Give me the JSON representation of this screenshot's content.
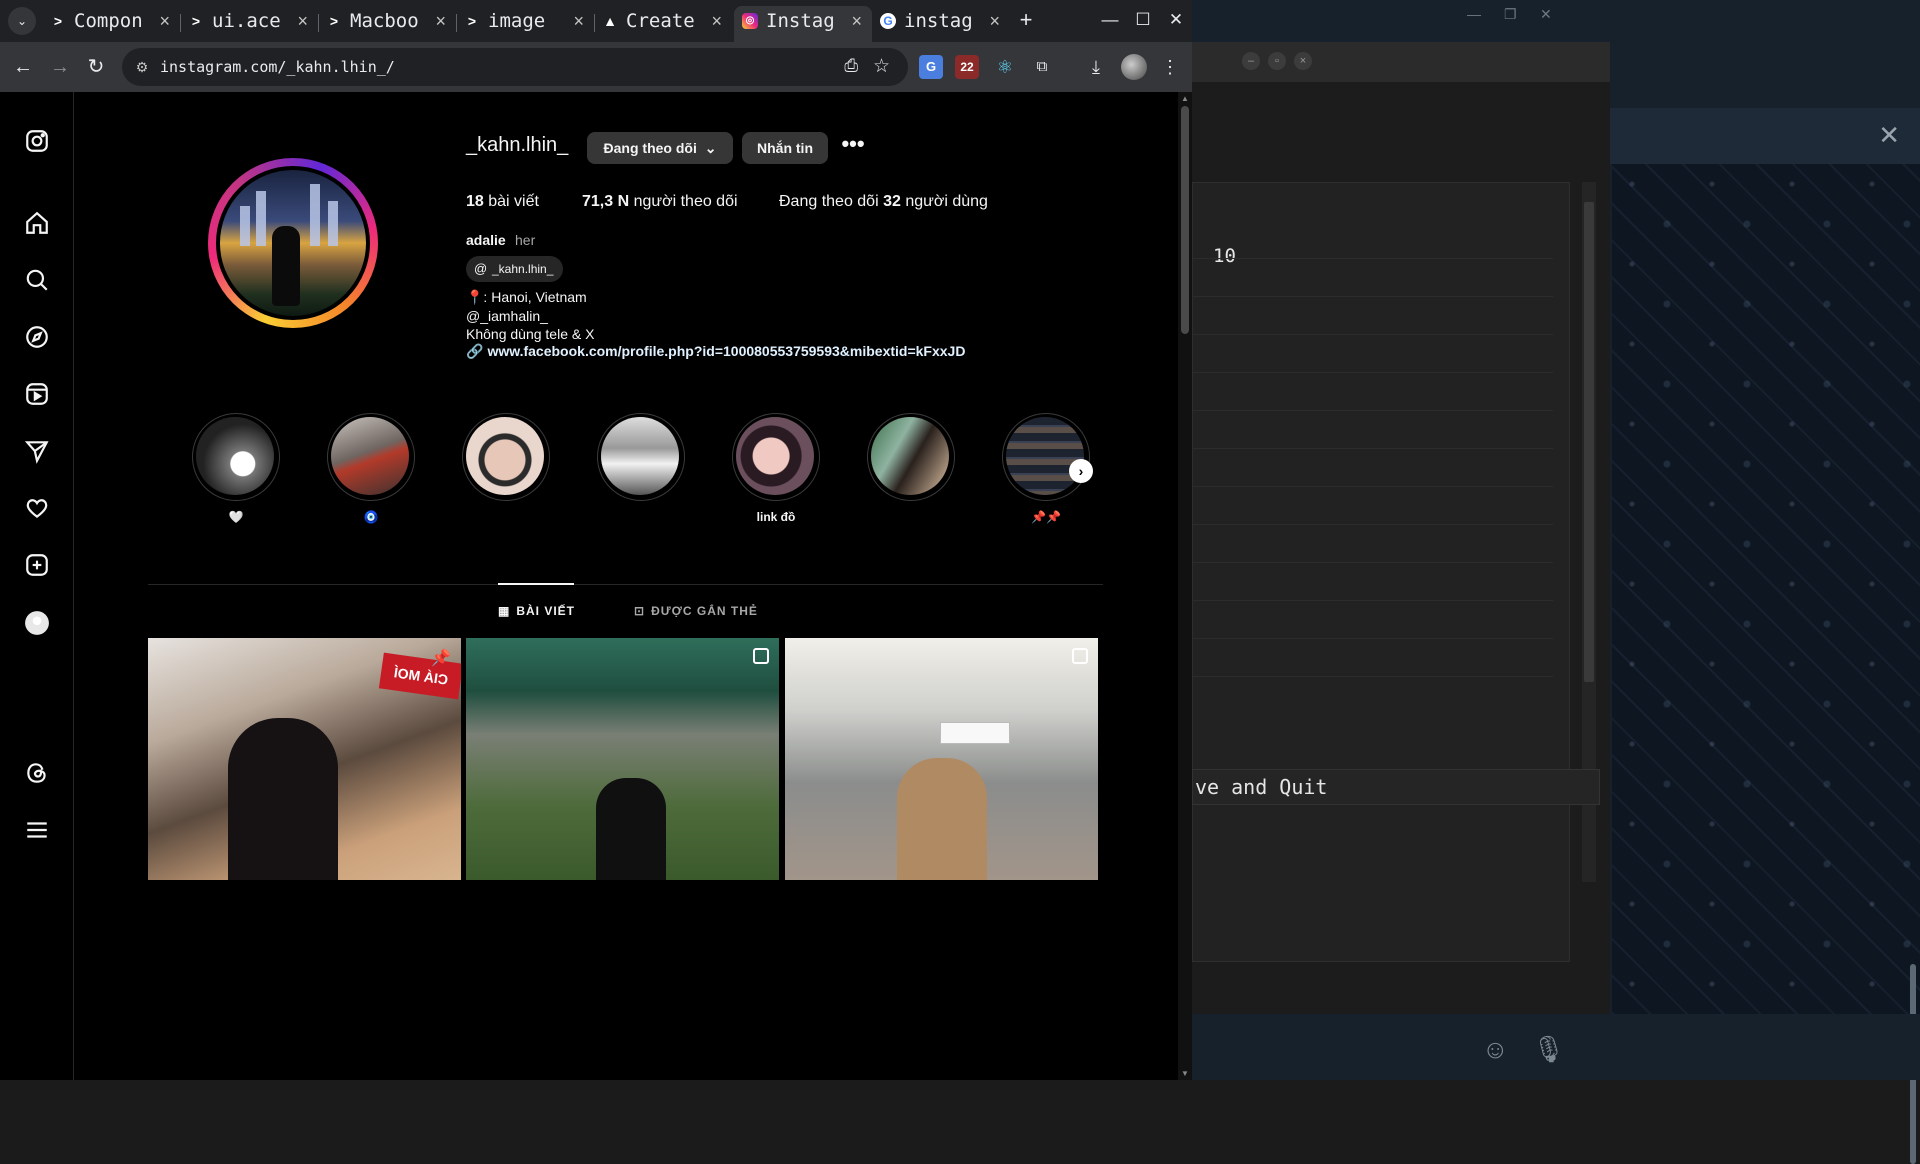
{
  "browser": {
    "tabs": [
      {
        "favicon": ">",
        "title": "Compon",
        "active": false
      },
      {
        "favicon": ">",
        "title": "ui.ace",
        "active": false
      },
      {
        "favicon": ">",
        "title": "Macboo",
        "active": false
      },
      {
        "favicon": ">",
        "title": "image",
        "active": false
      },
      {
        "favicon": "▲",
        "title": "Create",
        "active": false
      },
      {
        "favicon": "◎",
        "title": "Instag",
        "active": true
      },
      {
        "favicon": "G",
        "title": "instag",
        "active": false
      }
    ],
    "tab_close": "×",
    "new_tab": "+",
    "window_controls": {
      "minimize": "—",
      "maximize": "☐",
      "close": "✕"
    },
    "nav": {
      "back": "←",
      "forward": "→",
      "reload": "↻"
    },
    "url": "instagram.com/_kahn.lhin_/",
    "extensions": {
      "translate": "G",
      "calendar_badge": "22",
      "react": "⚛",
      "puzzle": "⧉",
      "download": "⤓",
      "menu": "⋮"
    }
  },
  "instagram": {
    "username": "_kahn.lhin_",
    "follow_button": "Đang theo dõi",
    "follow_chevron": "⌄",
    "message_button": "Nhắn tin",
    "more_button": "•••",
    "stats": {
      "posts_count": "18",
      "posts_label": "bài viết",
      "followers_count": "71,3 N",
      "followers_label": "người theo dõi",
      "following_prefix": "Đang theo dõi",
      "following_count": "32",
      "following_label": "người dùng"
    },
    "full_name": "adalie",
    "pronouns": "her",
    "threads_handle": "_kahn.lhin_",
    "bio": {
      "line1": "📍: Hanoi, Vietnam",
      "line2": "@_iamhalin_",
      "line3": "Không dùng tele & X"
    },
    "link": "www.facebook.com/profile.php?id=100080553759593&mibextid=kFxxJD",
    "highlights": [
      {
        "label": "🤍",
        "bg": "#6b6b6b"
      },
      {
        "label": "🧿",
        "bg": "#5a4a44"
      },
      {
        "label": "",
        "bg": "#b59a8a"
      },
      {
        "label": "",
        "bg": "#8a8a8a"
      },
      {
        "label": "link đồ",
        "bg": "#7a5f66"
      },
      {
        "label": "",
        "bg": "#4f6a52"
      },
      {
        "label": "📌📌",
        "bg": "#2a2f3a"
      }
    ],
    "tabs": {
      "posts": "BÀI VIẾT",
      "tagged": "ĐƯỢC GẮN THẺ"
    },
    "post_sign_text": "ÌOM ÀIƆ"
  },
  "background_app": {
    "dialog_value": "10",
    "dialog_button": "ve and Quit"
  }
}
